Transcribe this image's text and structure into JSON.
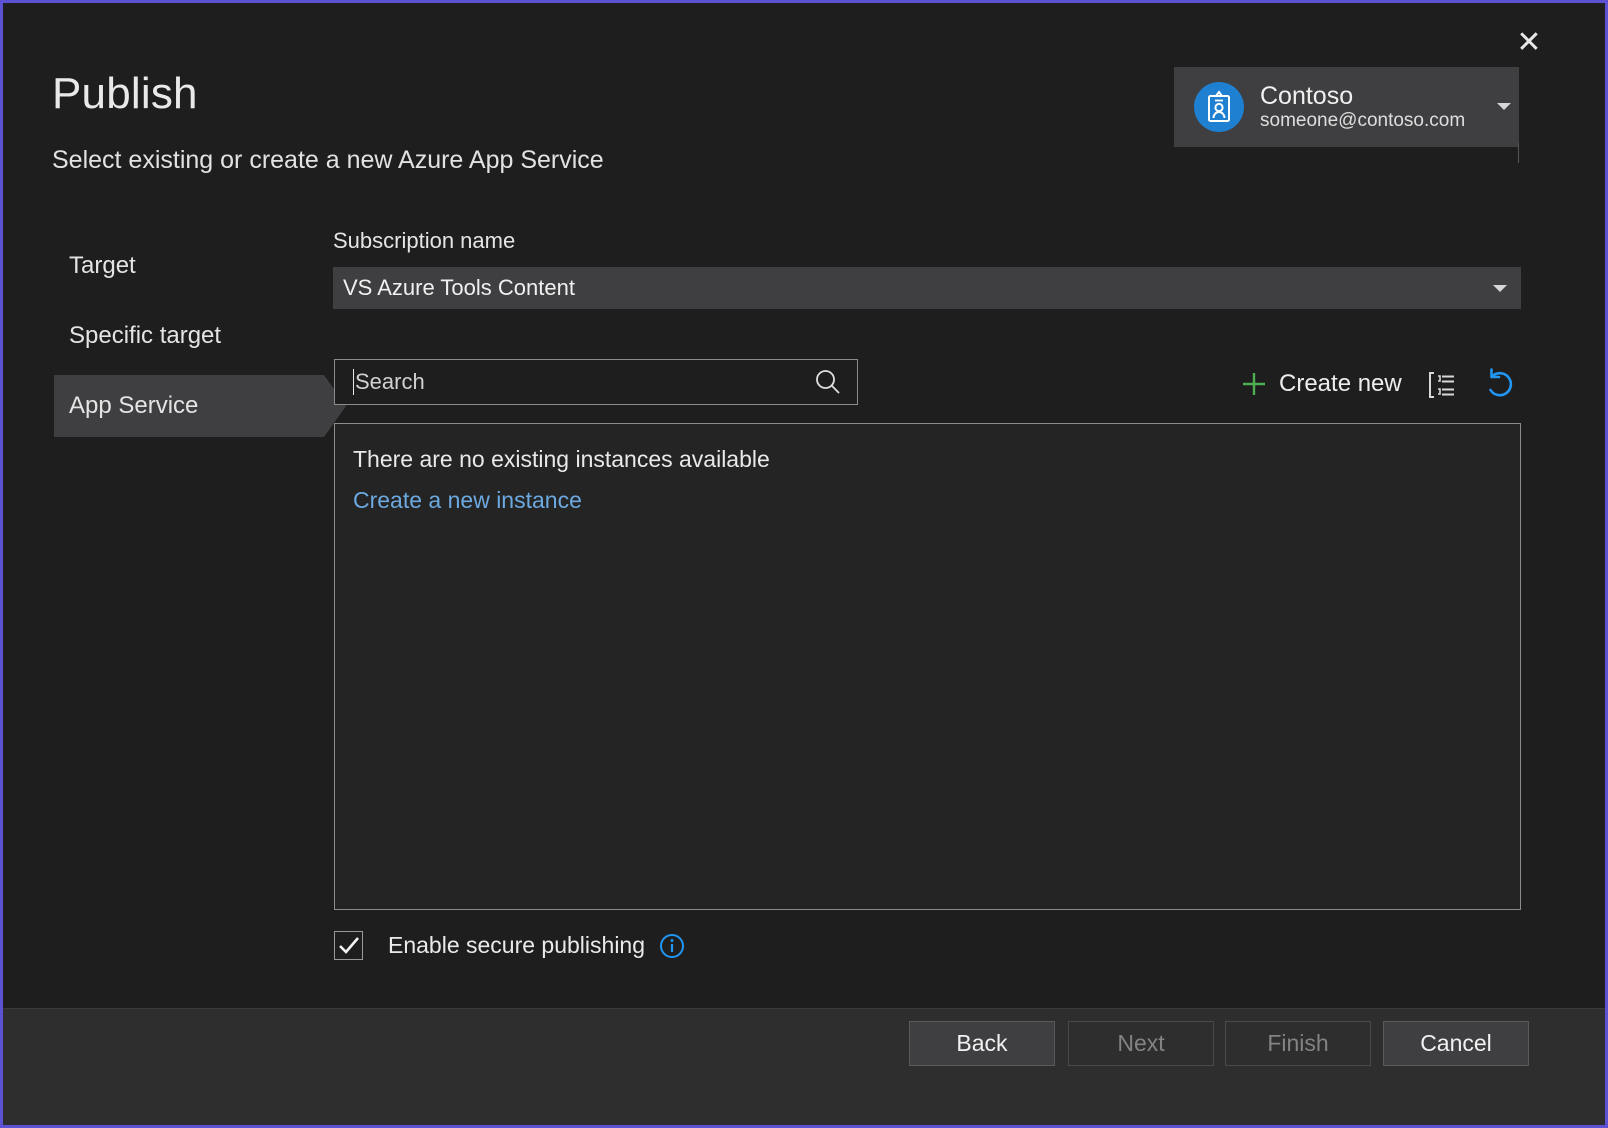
{
  "window": {
    "close_label": "✕",
    "title": "Publish",
    "subtitle": "Select existing or create a new Azure App Service",
    "accent_purple": "#5b53d3"
  },
  "account": {
    "name": "Contoso",
    "email": "someone@contoso.com",
    "avatar_icon": "id-badge-icon",
    "avatar_color": "#1f7fd0",
    "chevron_icon": "chevron-down-icon"
  },
  "nav": {
    "items": [
      {
        "label": "Target",
        "selected": false
      },
      {
        "label": "Specific target",
        "selected": false
      },
      {
        "label": "App Service",
        "selected": true
      }
    ]
  },
  "subscription": {
    "label": "Subscription name",
    "value": "VS Azure Tools Content",
    "caret_icon": "chevron-down-icon"
  },
  "search": {
    "placeholder": "Search",
    "value": "",
    "icon": "search-icon"
  },
  "toolbar": {
    "create_new_label": "Create new",
    "create_new_icon": "plus-icon",
    "create_new_icon_color": "#4caf50",
    "group_icon": "group-by-icon",
    "refresh_icon": "refresh-icon",
    "refresh_icon_color": "#2196f3"
  },
  "instances": {
    "empty_text": "There are no existing instances available",
    "create_link": "Create a new instance",
    "link_color": "#6ca9e0",
    "items": []
  },
  "secure_publishing": {
    "label": "Enable secure publishing",
    "checked": true,
    "check_icon": "checkmark-icon",
    "info_icon": "info-circle-icon",
    "info_icon_color": "#2196f3"
  },
  "footer": {
    "buttons": [
      {
        "label": "Back",
        "enabled": true
      },
      {
        "label": "Next",
        "enabled": false
      },
      {
        "label": "Finish",
        "enabled": false
      },
      {
        "label": "Cancel",
        "enabled": true
      }
    ]
  }
}
